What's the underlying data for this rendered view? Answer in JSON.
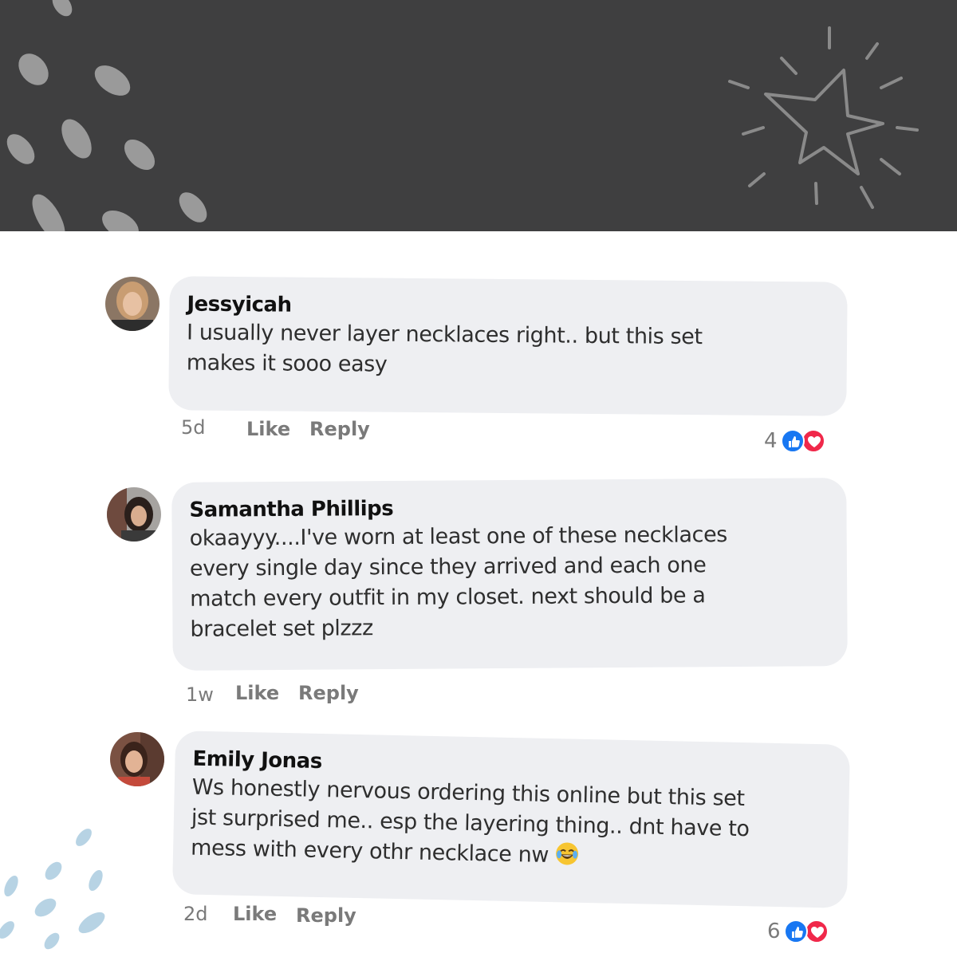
{
  "comments": [
    {
      "author": "Jessyicah",
      "lines": [
        "I usually never layer necklaces right.. but this set",
        "makes it sooo easy"
      ],
      "time": "5d",
      "like_label": "Like",
      "reply_label": "Reply",
      "reaction_count": "4"
    },
    {
      "author": "Samantha Phillips",
      "lines": [
        "okaayyy....I've worn at least one of these necklaces",
        "every single day since they arrived and each one",
        "match every outfit in my closet. next should be a",
        "bracelet set plzzz"
      ],
      "time": "1w",
      "like_label": "Like",
      "reply_label": "Reply"
    },
    {
      "author": "Emily Jonas",
      "lines": [
        "Ws honestly nervous ordering this online but this set",
        "jst surprised me.. esp the layering thing.. dnt have to",
        "mess with every othr necklace nw"
      ],
      "time": "2d",
      "like_label": "Like",
      "reply_label": "Reply",
      "reaction_count": "6"
    }
  ],
  "colors": {
    "header_band": "#3f3f40",
    "bubble": "#eeeff2",
    "like_blue": "#1877f2",
    "love_red": "#f0284a",
    "gray_dots": "#9a9a9a",
    "blue_dots": "#b7d3e4"
  },
  "icons": [
    "sparkle-star-icon",
    "like-icon",
    "love-icon",
    "laughing-emoji-icon"
  ]
}
